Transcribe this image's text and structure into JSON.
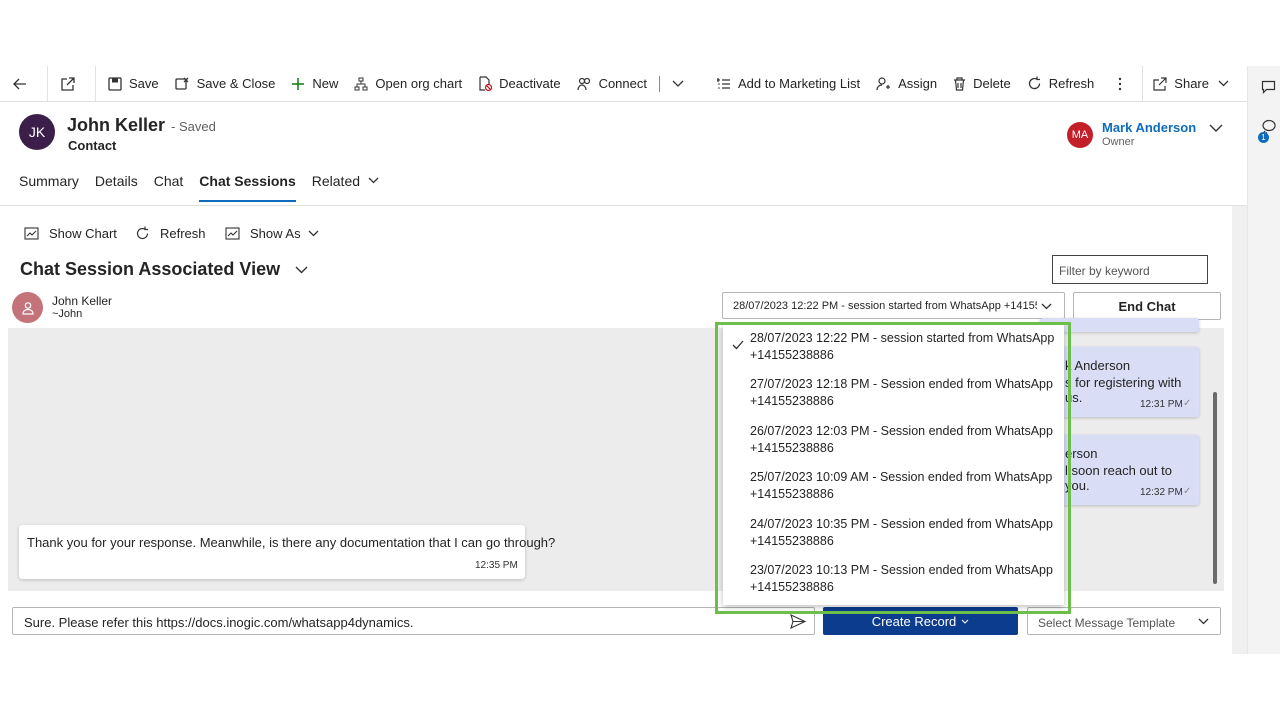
{
  "toolbar": {
    "save": "Save",
    "save_close": "Save & Close",
    "new": "New",
    "org_chart": "Open org chart",
    "deactivate": "Deactivate",
    "connect": "Connect",
    "add_marketing": "Add to Marketing List",
    "assign": "Assign",
    "delete": "Delete",
    "refresh": "Refresh",
    "share": "Share"
  },
  "record": {
    "initials": "JK",
    "name": "John Keller",
    "status": "- Saved",
    "entity": "Contact",
    "owner_initials": "MA",
    "owner_name": "Mark Anderson",
    "owner_role": "Owner"
  },
  "rail": {
    "badge": "1"
  },
  "tabs": [
    "Summary",
    "Details",
    "Chat",
    "Chat Sessions",
    "Related"
  ],
  "subgrid": {
    "show_chart": "Show Chart",
    "refresh": "Refresh",
    "show_as": "Show As",
    "view_title": "Chat Session Associated View",
    "filter_placeholder": "Filter by keyword"
  },
  "chat": {
    "contact_name": "John Keller",
    "contact_handle": "~John",
    "selected_session": "28/07/2023 12:22 PM - session started from WhatsApp +14155238886",
    "end_chat": "End Chat",
    "outgoing": [
      {
        "line1": "k Anderson",
        "line2": "s for registering with us.",
        "time": "12:31 PM"
      },
      {
        "line1": "erson",
        "line2": "l soon reach out to you.",
        "time": "12:32 PM"
      }
    ],
    "incoming": {
      "text": "Thank you for your response. Meanwhile, is there any documentation that I can go through?",
      "time": "12:35 PM"
    },
    "composer_value": "Sure. Please refer this https://docs.inogic.com/whatsapp4dynamics.",
    "create_record": "Create Record",
    "template_placeholder": "Select Message Template"
  },
  "sessions": [
    {
      "line1": "28/07/2023 12:22 PM - session started from WhatsApp",
      "line2": "+14155238886",
      "selected": true
    },
    {
      "line1": "27/07/2023 12:18 PM - Session ended from WhatsApp",
      "line2": "+14155238886",
      "selected": false
    },
    {
      "line1": "26/07/2023 12:03 PM - Session ended from WhatsApp",
      "line2": "+14155238886",
      "selected": false
    },
    {
      "line1": "25/07/2023 10:09 AM - Session ended from WhatsApp",
      "line2": "+14155238886",
      "selected": false
    },
    {
      "line1": "24/07/2023 10:35 PM - Session ended from WhatsApp",
      "line2": "+14155238886",
      "selected": false
    },
    {
      "line1": "23/07/2023 10:13 PM - Session ended from WhatsApp",
      "line2": "+14155238886",
      "selected": false
    }
  ],
  "colors": {
    "accent": "#0f6cbd",
    "primary_button": "#0c3c8e",
    "highlight": "#6cc04a",
    "avatar_jk": "#3b1f4a",
    "avatar_ma": "#c41e2a"
  }
}
